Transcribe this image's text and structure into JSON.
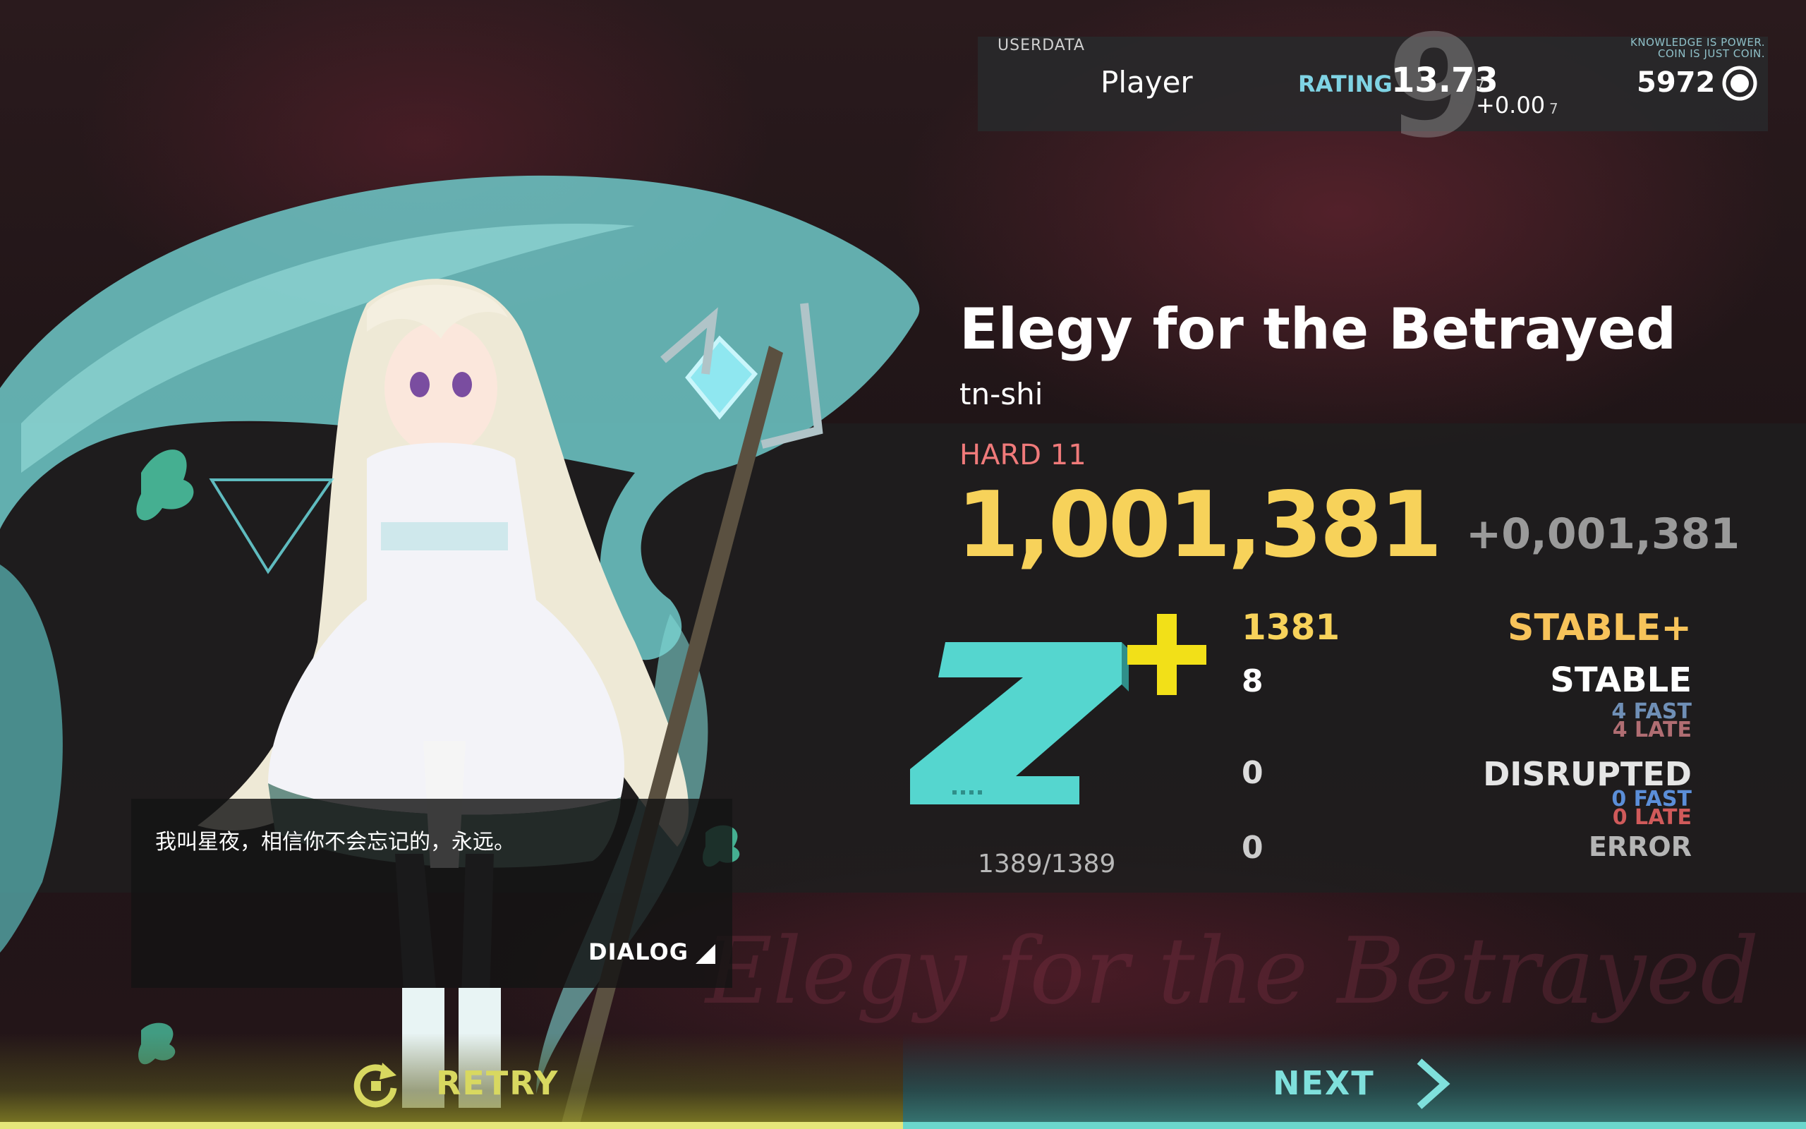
{
  "userdata": {
    "label": "USERDATA",
    "player": "Player",
    "level": "9",
    "rating_label": "RATING",
    "rating": "13.73",
    "rating_sub": "7",
    "rating_delta": "+0.00",
    "rating_delta_sub": "7",
    "motto_line1": "KNOWLEDGE IS POWER.",
    "motto_line2": "COIN IS JUST COIN.",
    "coins": "5972"
  },
  "song": {
    "title": "Elegy for the Betrayed",
    "artist": "tn-shi",
    "difficulty": "HARD 11",
    "score": "1,001,381",
    "score_delta": "+0,001,381",
    "rank_letter": "Z",
    "rank_modifier": "+",
    "total_notes": "1389/1389"
  },
  "judgements": {
    "stable_plus": {
      "label": "STABLE+",
      "count": "1381"
    },
    "stable": {
      "label": "STABLE",
      "count": "8",
      "fast": "4 FAST",
      "late": "4 LATE"
    },
    "disrupted": {
      "label": "DISRUPTED",
      "count": "0",
      "fast": "0 FAST",
      "late": "0 LATE"
    },
    "error": {
      "label": "ERROR",
      "count": "0"
    }
  },
  "dialog": {
    "text": "我叫星夜，相信你不会忘记的，永远。",
    "button": "DIALOG"
  },
  "actions": {
    "retry": "RETRY",
    "next": "NEXT"
  },
  "colors": {
    "score": "#f7d25a",
    "difficulty": "#f07a7a",
    "rank": "#55d6cf",
    "next_bar": "#6bd6cc",
    "retry_bar": "#e6e67a"
  },
  "icons": [
    "coin-icon",
    "retry-icon",
    "chevron-right-icon"
  ],
  "background_text": "Elegy for the Betrayed"
}
